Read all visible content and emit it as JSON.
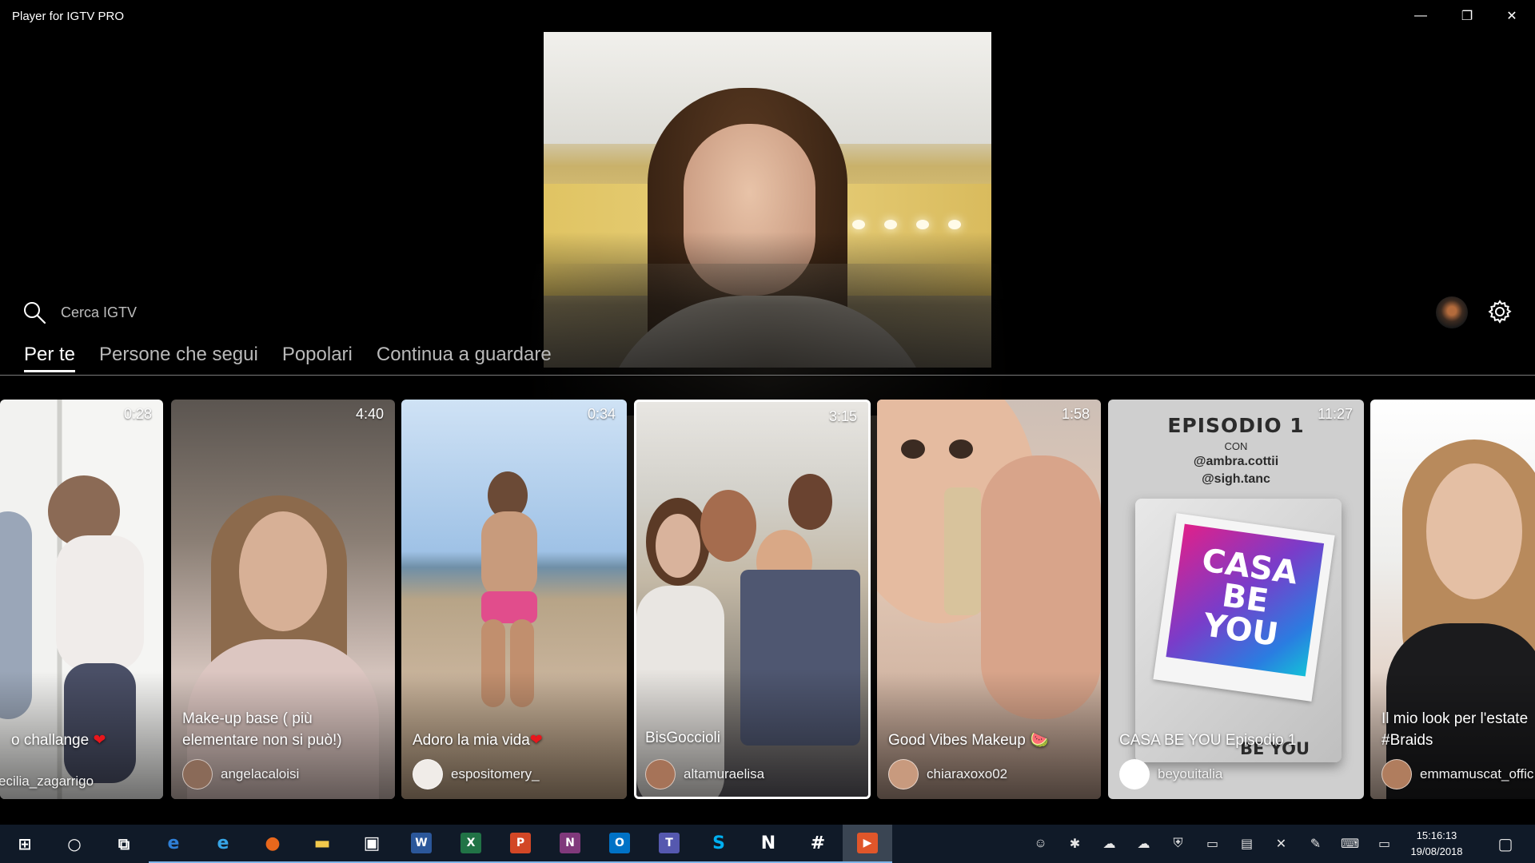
{
  "window": {
    "title": "Player for IGTV PRO",
    "minimize_label": "—",
    "maximize_label": "❐",
    "close_label": "✕"
  },
  "search": {
    "placeholder": "Cerca IGTV"
  },
  "tabs": [
    {
      "label": "Per te",
      "active": true
    },
    {
      "label": "Persone che segui",
      "active": false
    },
    {
      "label": "Popolari",
      "active": false
    },
    {
      "label": "Continua a guardare",
      "active": false
    }
  ],
  "videos": [
    {
      "duration": "0:28",
      "title": "o challange",
      "heart": "❤",
      "author": "ecilia_zagarrigo"
    },
    {
      "duration": "4:40",
      "title": "Make-up base ( più elementare non si può!)",
      "heart": "",
      "author": "angelacaloisi"
    },
    {
      "duration": "0:34",
      "title": "Adoro la mia vida",
      "heart": "❤",
      "author": "espositomery_"
    },
    {
      "duration": "3:15",
      "title": "BisGoccioli",
      "heart": "",
      "author": "altamuraelisa",
      "selected": true
    },
    {
      "duration": "1:58",
      "title": "Good Vibes Makeup 🍉",
      "heart": "",
      "author": "chiaraxoxo02"
    },
    {
      "duration": "11:27",
      "title": "CASA BE YOU Episodio 1",
      "heart": "",
      "author": "beyouitalia",
      "poster": {
        "episode": "EPISODIO 1",
        "con": "CON",
        "guests": [
          "@ambra.cottii",
          "@sigh.tanc"
        ],
        "art_text": "CASA BE YOU",
        "logo": "BE YOU"
      }
    },
    {
      "duration": "",
      "title": "Il mio look per l'estate #Braids",
      "heart": "",
      "author": "emmamuscat_offic"
    }
  ],
  "taskbar": {
    "apps": [
      {
        "name": "start",
        "glyph": "⊞"
      },
      {
        "name": "cortana",
        "glyph": "○"
      },
      {
        "name": "task-view",
        "glyph": "⧉"
      },
      {
        "name": "edge",
        "glyph": "e",
        "color": "#2f7fd6"
      },
      {
        "name": "internet-explorer",
        "glyph": "e",
        "color": "#37a5e6"
      },
      {
        "name": "firefox",
        "glyph": "●",
        "color": "#e8671c"
      },
      {
        "name": "file-explorer",
        "glyph": "▬",
        "color": "#f2c94c"
      },
      {
        "name": "store",
        "glyph": "▣",
        "color": "#ffffff"
      },
      {
        "name": "word",
        "glyph": "W",
        "color": "#2b579a"
      },
      {
        "name": "excel",
        "glyph": "X",
        "color": "#217346"
      },
      {
        "name": "powerpoint",
        "glyph": "P",
        "color": "#d24726"
      },
      {
        "name": "onenote",
        "glyph": "N",
        "color": "#80397b"
      },
      {
        "name": "outlook",
        "glyph": "O",
        "color": "#0072c6"
      },
      {
        "name": "teams",
        "glyph": "T",
        "color": "#5558af"
      },
      {
        "name": "skype",
        "glyph": "S",
        "color": "#00aff0"
      },
      {
        "name": "n-app",
        "glyph": "N",
        "color": "#ffffff"
      },
      {
        "name": "slack",
        "glyph": "#",
        "color": "#ffffff"
      },
      {
        "name": "igtv-player",
        "glyph": "▶",
        "color": "#e0562a"
      }
    ],
    "tray": [
      {
        "name": "people",
        "glyph": "☺"
      },
      {
        "name": "slack-tray",
        "glyph": "✱"
      },
      {
        "name": "onedrive-blue",
        "glyph": "☁"
      },
      {
        "name": "onedrive-white",
        "glyph": "☁"
      },
      {
        "name": "security",
        "glyph": "⛨"
      },
      {
        "name": "battery",
        "glyph": "▭"
      },
      {
        "name": "network",
        "glyph": "▤"
      },
      {
        "name": "volume-muted",
        "glyph": "✕"
      },
      {
        "name": "pen",
        "glyph": "✎"
      },
      {
        "name": "keyboard",
        "glyph": "⌨"
      },
      {
        "name": "tablet-mode",
        "glyph": "▭"
      }
    ],
    "time": "15:16:13",
    "date": "19/08/2018",
    "notifications_glyph": "▢"
  }
}
